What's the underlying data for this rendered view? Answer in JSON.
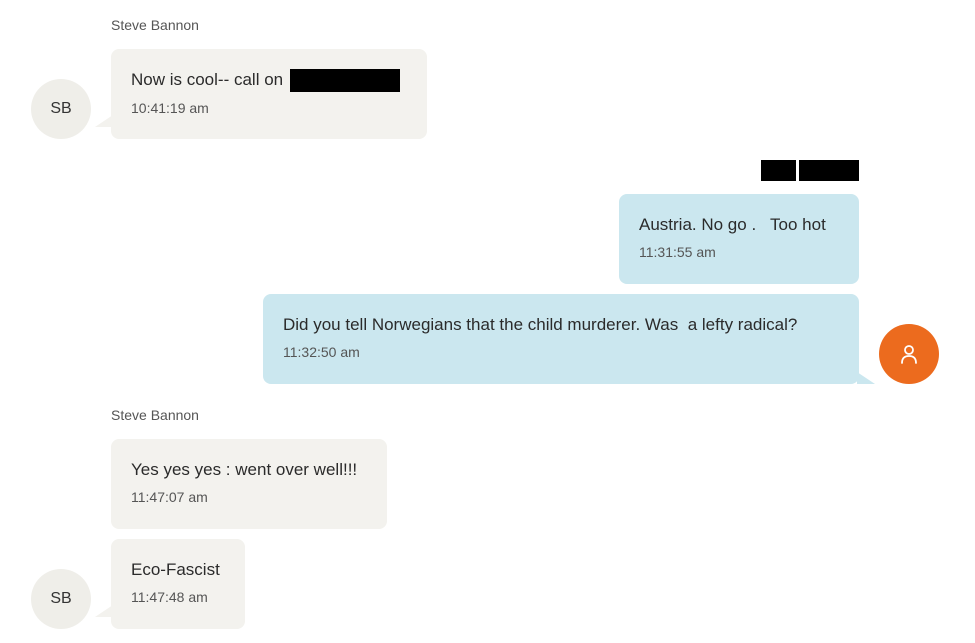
{
  "conversation": {
    "messages": [
      {
        "sender": "Steve Bannon",
        "initials": "SB",
        "text": "Now is cool-- call on",
        "redacted": true,
        "time": "10:41:19 am"
      },
      {
        "text": "Austria. No go .   Too hot",
        "time": "11:31:55 am"
      },
      {
        "text": "Did you tell Norwegians that the child murderer. Was  a lefty radical?",
        "time": "11:32:50 am"
      },
      {
        "sender": "Steve Bannon",
        "text": "Yes yes yes : went over well!!!",
        "time": "11:47:07 am"
      },
      {
        "initials": "SB",
        "text": "Eco-Fascist",
        "time": "11:47:48 am"
      }
    ]
  },
  "colors": {
    "incoming_bubble": "#f3f2ee",
    "outgoing_bubble": "#cbe7ef",
    "self_avatar": "#ec6b1e",
    "redaction": "#000000"
  },
  "icons": {
    "self_avatar": "person-icon"
  }
}
